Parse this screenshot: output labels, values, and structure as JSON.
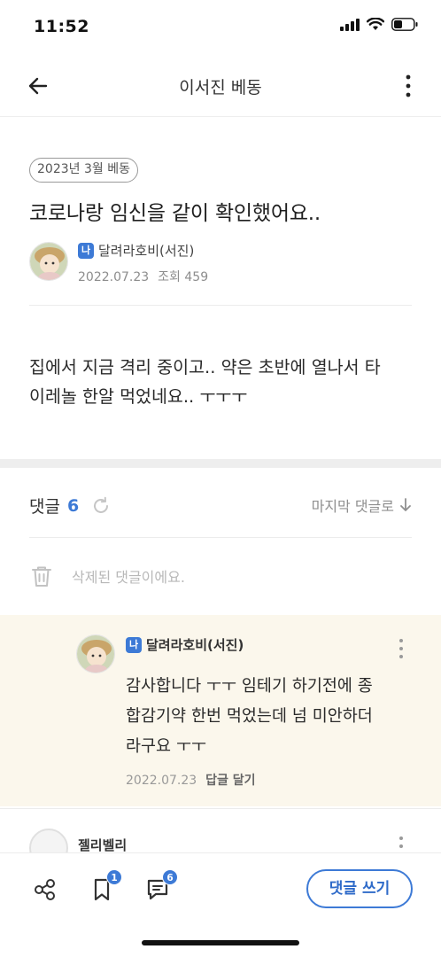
{
  "status_bar": {
    "time": "11:52"
  },
  "header": {
    "title": "이서진 베동"
  },
  "post": {
    "category": "2023년 3월 베동",
    "title": "코로나랑 임신을 같이 확인했어요..",
    "author": {
      "level": "나",
      "name": "달려라호비(서진)"
    },
    "date": "2022.07.23",
    "views": "조회 459",
    "body_line1": "집에서 지금 격리 중이고.. 약은 초반에 열나서 타",
    "body_line2": "이레놀 한알 먹었네요.. ㅜㅜㅜ"
  },
  "comments": {
    "label": "댓글",
    "count": "6",
    "sort_label": "마지막 댓글로",
    "deleted_text": "삭제된 댓글이에요.",
    "reply": {
      "level": "나",
      "author": "달려라호비(서진)",
      "line1": "감사합니다 ㅜㅜ 임테기 하기전에 종",
      "line2": "합감기약 한번 먹었는데 넘 미안하더",
      "line3": "라구요 ㅜㅜ",
      "date": "2022.07.23",
      "action": "답글 달기"
    },
    "next_author": "젤리벨리"
  },
  "bottom_bar": {
    "bookmark_count": "1",
    "comment_count": "6",
    "write_label": "댓글 쓰기"
  },
  "colors": {
    "accent": "#3d7ad6",
    "reply_bg": "#fbf7ec"
  }
}
